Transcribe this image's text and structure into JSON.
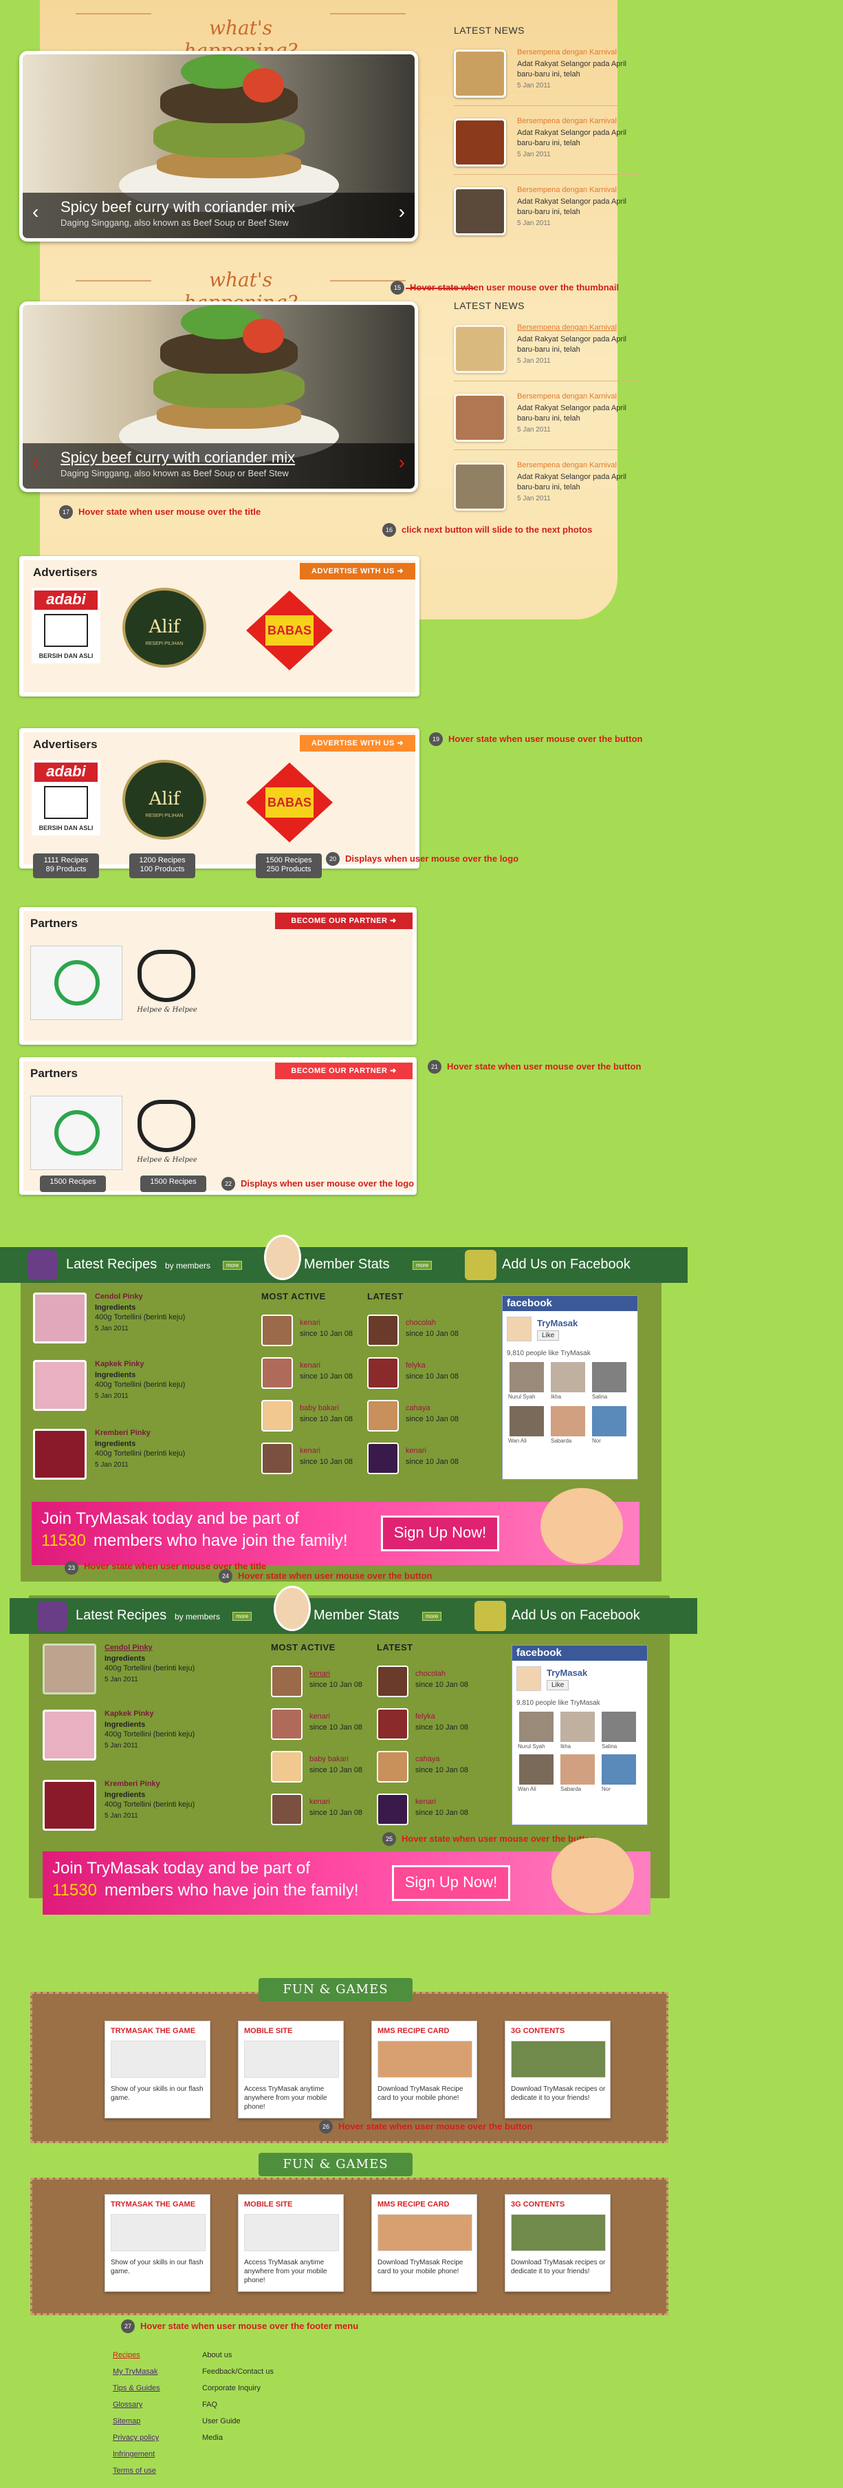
{
  "happening": {
    "title": "what's happening?",
    "slide_title": "Spicy beef curry with coriander mix",
    "slide_sub": "Daging Singgang, also known as Beef Soup or Beef Stew",
    "left_arrow": "‹",
    "right_arrow": "›"
  },
  "news": {
    "head": "LATEST NEWS",
    "items": [
      {
        "title": "Bersempena dengan Karnival",
        "body": "Adat Rakyat Selangor pada April baru-baru ini, telah",
        "date": "5 Jan 2011"
      },
      {
        "title": "Bersempena dengan Karnival",
        "body": "Adat Rakyat Selangor pada April baru-baru ini, telah",
        "date": "5 Jan 2011"
      },
      {
        "title": "Bersempena dengan Karnival",
        "body": "Adat Rakyat Selangor pada April baru-baru ini, telah",
        "date": "5 Jan 2011"
      }
    ]
  },
  "notes": {
    "n15": "Hover state when user mouse over the thumbnail",
    "n17": "Hover state when user mouse over the title",
    "n16": "click next button will slide to the next  photos",
    "n19": "Hover state when user mouse over the button",
    "n20": "Displays when user mouse over the logo",
    "n21": "Hover state when user mouse over the button",
    "n22": "Displays when user mouse over the logo",
    "n23": "Hover state when user mouse over the title",
    "n24": "Hover state when user mouse over the button",
    "n25": "Hover state when user mouse over the button",
    "n26": "Hover state when user mouse over the button",
    "n27": "Hover state when user mouse over the footer menu"
  },
  "numbers": {
    "n15": "15",
    "n17": "17",
    "n16": "16",
    "n19": "19",
    "n20": "20",
    "n21": "21",
    "n22": "22",
    "n23": "23",
    "n24": "24",
    "n25": "25",
    "n26": "26",
    "n27": "27"
  },
  "advertisers": {
    "title": "Advertisers",
    "button": "ADVERTISE WITH US ➜",
    "adabi": "adabi",
    "adabi_tag": "BERSIH DAN ASLI",
    "alif": "Alif",
    "alif_tag": "RESEPI PILIHAN",
    "babas": "BABAS",
    "tips": [
      {
        "a": "1111 Recipes",
        "b": "89 Products"
      },
      {
        "a": "1200 Recipes",
        "b": "100 Products"
      },
      {
        "a": "1500 Recipes",
        "b": "250 Products"
      }
    ]
  },
  "partners": {
    "title": "Partners",
    "button": "BECOME OUR PARTNER ➜",
    "helpee": "Helpee & Helpee",
    "tip": "1500 Recipes"
  },
  "community": {
    "latest_recipes": "Latest Recipes",
    "by_members": "by members",
    "more": "more",
    "member_stats": "Member Stats",
    "add_us": "Add Us on Facebook",
    "recipes": [
      {
        "name": "Cendol Pinky",
        "ing": "Ingredients",
        "qty": "400g Tortellini (berinti keju)",
        "date": "5 Jan 2011"
      },
      {
        "name": "Kapkek Pinky",
        "ing": "Ingredients",
        "qty": "400g Tortellini (berinti keju)",
        "date": "5 Jan 2011"
      },
      {
        "name": "Kremberi Pinky",
        "ing": "Ingredients",
        "qty": "400g Tortellini (berinti keju)",
        "date": "5 Jan 2011"
      }
    ],
    "most_active": "MOST ACTIVE",
    "latest": "LATEST",
    "active": [
      {
        "name": "kenari",
        "since": "since 10 Jan 08"
      },
      {
        "name": "kenari",
        "since": "since 10 Jan 08"
      },
      {
        "name": "baby bakari",
        "since": "since 10 Jan 08"
      },
      {
        "name": "kenari",
        "since": "since 10 Jan 08"
      }
    ],
    "latest_members": [
      {
        "name": "chocolah",
        "since": "since 10 Jan 08"
      },
      {
        "name": "felyka",
        "since": "since 10 Jan 08"
      },
      {
        "name": "cahaya",
        "since": "since 10 Jan 08"
      },
      {
        "name": "kenari",
        "since": "since 10 Jan 08"
      }
    ],
    "fb": {
      "brand": "facebook",
      "page": "TryMasak",
      "like": "Like",
      "count": "9,810 people like TryMasak",
      "fans": [
        "Nurul Syah",
        "Ikha",
        "Salina",
        "Wan Ali",
        "Sabarda",
        "Nor"
      ]
    },
    "join_line1": "Join TryMasak today and be part of",
    "join_num": "11530",
    "join_line2": "members who have join the family!",
    "signup": "Sign Up Now!"
  },
  "fun": {
    "title": "FUN & GAMES",
    "cards": [
      {
        "title": "TRYMASAK THE GAME",
        "desc": "Show of your skills in our flash game."
      },
      {
        "title": "MOBILE SITE",
        "desc": "Access TryMasak anytime anywhere from your mobile phone!"
      },
      {
        "title": "MMS RECIPE CARD",
        "desc": "Download TryMasak Recipe card to your mobile phone!"
      },
      {
        "title": "3G CONTENTS",
        "desc": "Download TryMasak recipes or dedicate it to your friends!"
      }
    ]
  },
  "footer": {
    "col1": [
      "Recipes",
      "My TryMasak",
      "Tips & Guides",
      "Glossary",
      "Sitemap",
      "Privacy policy",
      "Infringement",
      "Terms of use"
    ],
    "col2": [
      "About us",
      "Feedback/Contact us",
      "Corporate Inquiry",
      "FAQ",
      "User Guide",
      "Media"
    ]
  },
  "colors": {
    "page_bg": "#a6dc54",
    "accent_red": "#d0201a",
    "green_bar": "#2f6b35",
    "pink": "#e02272"
  }
}
